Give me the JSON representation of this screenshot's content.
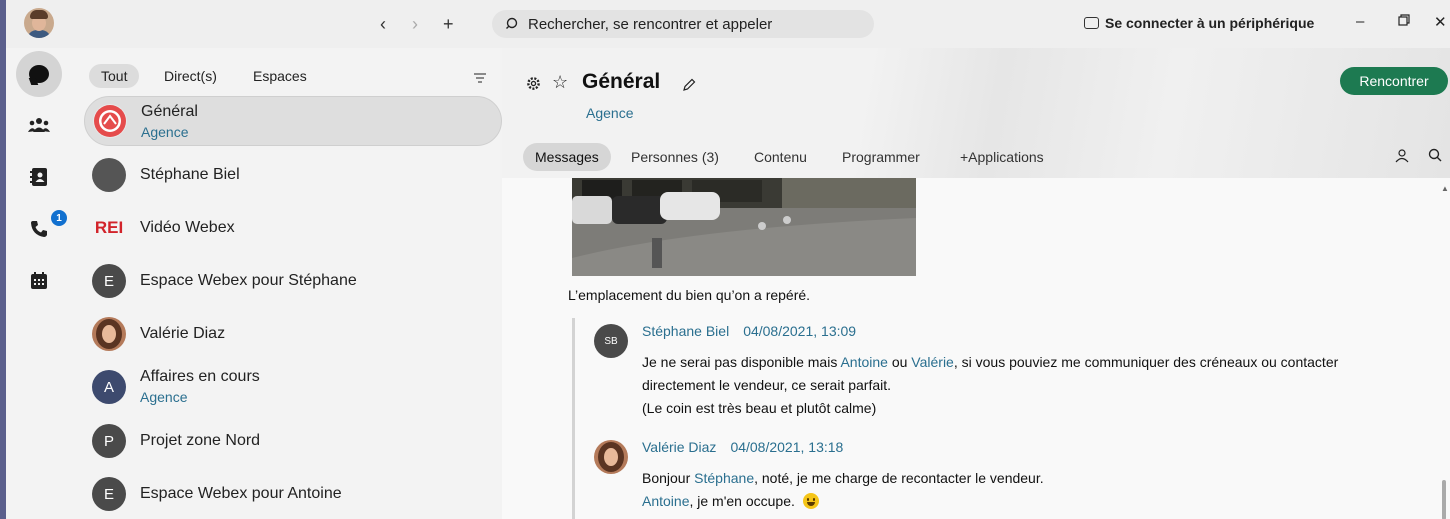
{
  "topbar": {
    "back_icon": "chevron-left-icon",
    "forward_icon": "chevron-right-icon",
    "new_icon": "plus-icon",
    "search_placeholder": "Rechercher, se rencontrer et appeler",
    "connect_label": "Se connecter à un périphérique"
  },
  "rail": {
    "items": [
      {
        "icon": "chat-icon"
      },
      {
        "icon": "teams-icon"
      },
      {
        "icon": "contacts-icon"
      },
      {
        "icon": "phone-icon",
        "badge": "1"
      },
      {
        "icon": "calendar-icon"
      }
    ]
  },
  "filters": {
    "all": "Tout",
    "direct": "Direct(s)",
    "spaces": "Espaces"
  },
  "conversations": [
    {
      "name": "Général",
      "sub": "Agence",
      "initial": ""
    },
    {
      "name": "Stéphane Biel",
      "sub": "",
      "initial": ""
    },
    {
      "name": "Vidéo Webex",
      "sub": "",
      "initial": "REI"
    },
    {
      "name": "Espace Webex pour Stéphane",
      "sub": "",
      "initial": "E"
    },
    {
      "name": "Valérie Diaz",
      "sub": "",
      "initial": ""
    },
    {
      "name": "Affaires en cours",
      "sub": "Agence",
      "initial": "A"
    },
    {
      "name": "Projet zone Nord",
      "sub": "",
      "initial": "P"
    },
    {
      "name": "Espace Webex pour Antoine",
      "sub": "",
      "initial": "E"
    }
  ],
  "space": {
    "title": "Général",
    "subtitle": "Agence",
    "meet_label": "Rencontrer",
    "tabs": [
      "Messages",
      "Personnes (3)",
      "Contenu",
      "Programmer",
      "+Applications"
    ]
  },
  "messages": {
    "caption": "L’emplacement du bien qu’on a repéré.",
    "m1": {
      "initials": "SB",
      "author": "Stéphane Biel",
      "date": "04/08/2021, 13:09",
      "l1_a": "Je ne serai pas disponible mais ",
      "l1_m1": "Antoine",
      "l1_b": " ou ",
      "l1_m2": "Valérie",
      "l1_c": ", si vous pouviez me communiquer des créneaux ou contacter",
      "l2": "directement le vendeur, ce serait parfait.",
      "l3": "(Le coin est très beau et plutôt calme)"
    },
    "m2": {
      "author": "Valérie Diaz",
      "date": "04/08/2021, 13:18",
      "l1_a": "Bonjour ",
      "l1_m": "Stéphane",
      "l1_b": ", noté, je me charge de recontacter le vendeur.",
      "l2_m": "Antoine",
      "l2_b": ", je m'en occupe."
    }
  }
}
